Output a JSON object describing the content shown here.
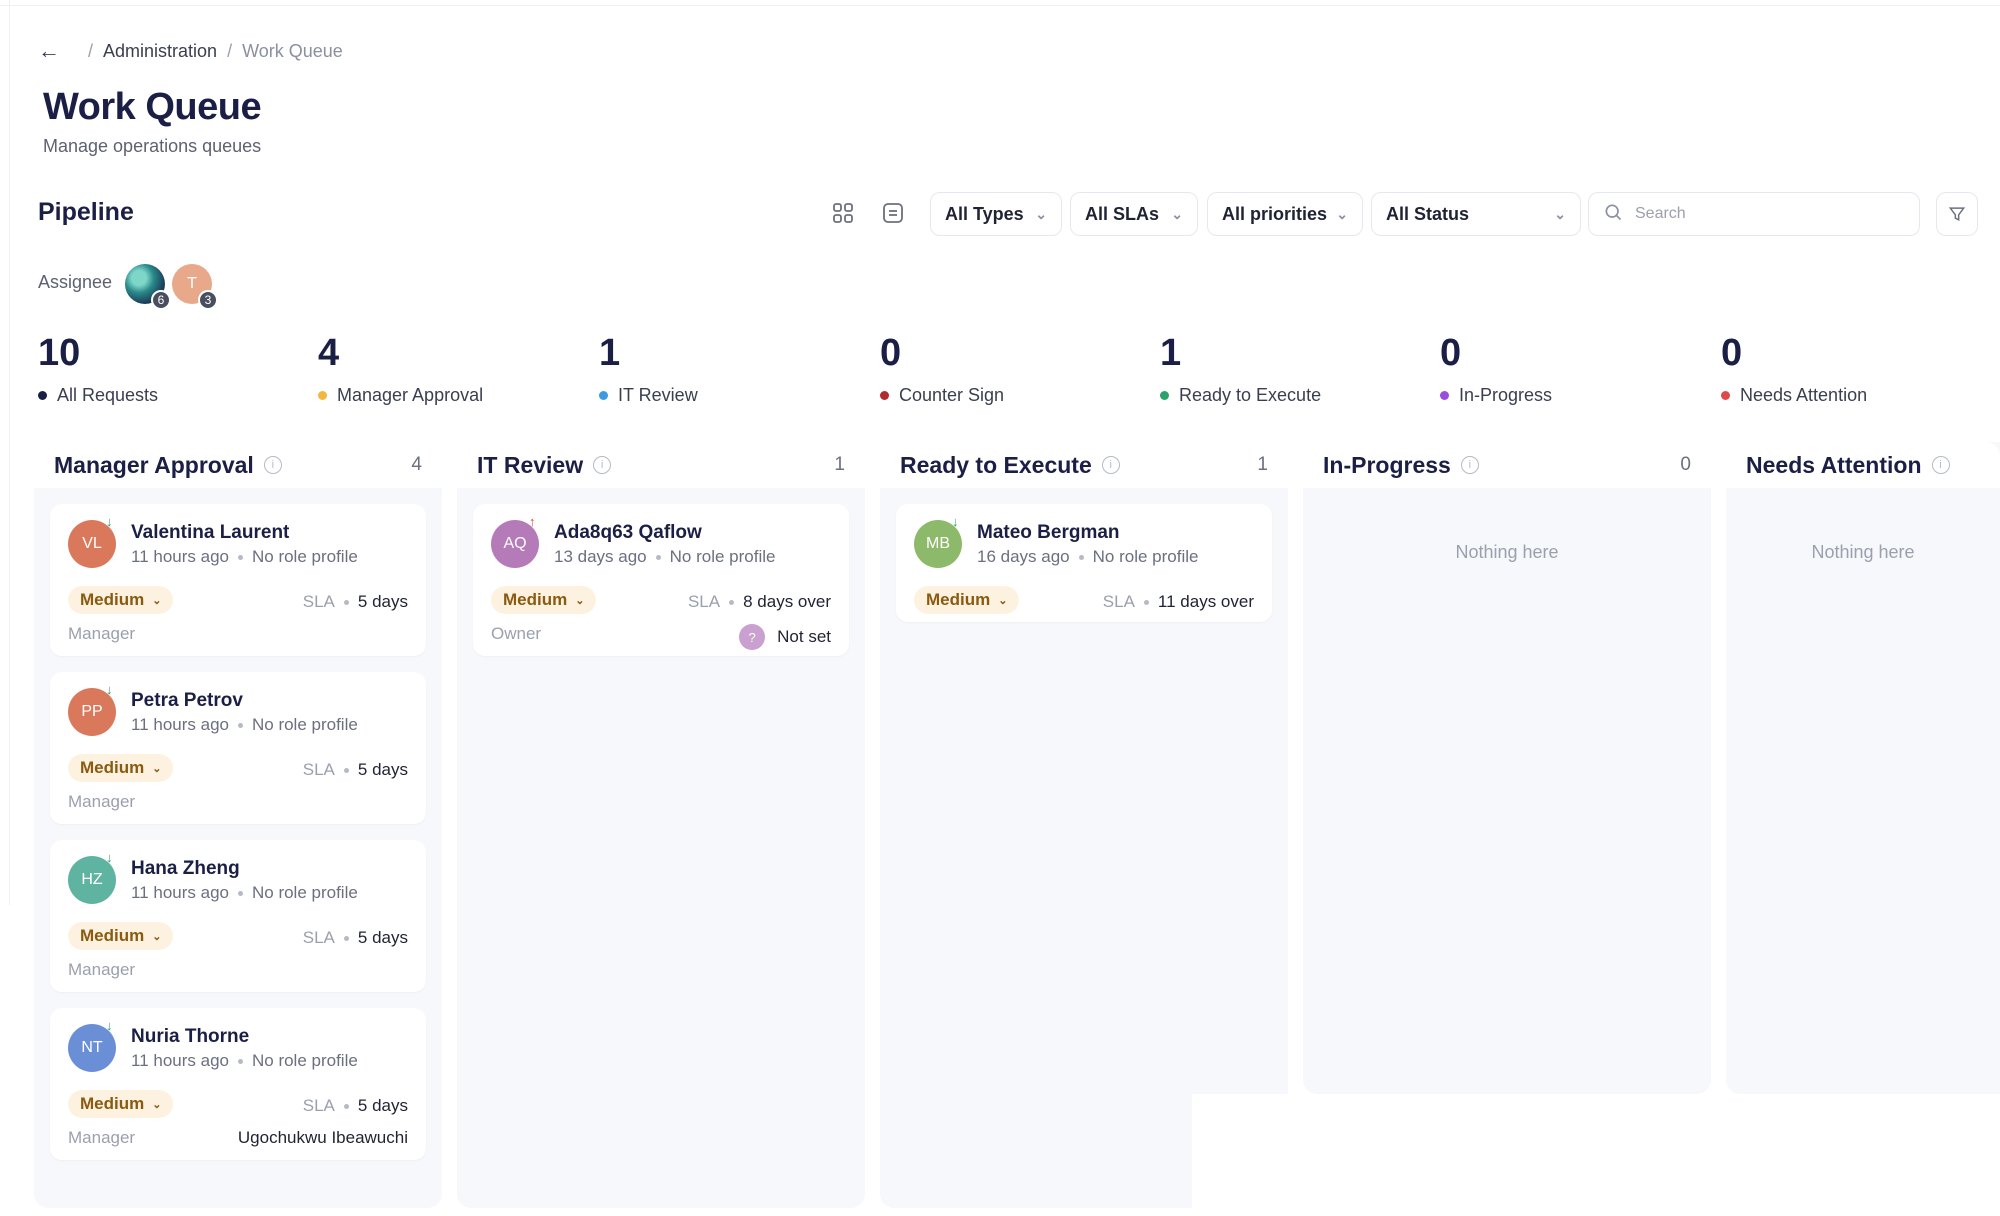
{
  "breadcrumb": {
    "back": "←",
    "separator": "/",
    "items": [
      "Administration",
      "Work Queue"
    ]
  },
  "page": {
    "title": "Work Queue",
    "subtitle": "Manage operations queues"
  },
  "pipeline": {
    "title": "Pipeline",
    "filters": {
      "types": "All Types",
      "slas": "All SLAs",
      "priorities": "All priorities",
      "status": "All Status"
    },
    "search_placeholder": "Search",
    "assignee": {
      "label": "Assignee",
      "avatars": [
        {
          "initials": "",
          "count": "6"
        },
        {
          "initials": "T",
          "count": "3"
        }
      ]
    }
  },
  "stats": [
    {
      "value": "10",
      "label": "All Requests",
      "color": "#1b1f45"
    },
    {
      "value": "4",
      "label": "Manager Approval",
      "color": "#f4b63c"
    },
    {
      "value": "1",
      "label": "IT Review",
      "color": "#3b9be0"
    },
    {
      "value": "0",
      "label": "Counter Sign",
      "color": "#b5282c"
    },
    {
      "value": "1",
      "label": "Ready to Execute",
      "color": "#2aa36a"
    },
    {
      "value": "0",
      "label": "In-Progress",
      "color": "#9a4de0"
    },
    {
      "value": "0",
      "label": "Needs Attention",
      "color": "#e04848"
    }
  ],
  "columns": [
    {
      "title": "Manager Approval",
      "count": "4",
      "cards": [
        {
          "initials": "VL",
          "name": "Valentina Laurent",
          "time": "11 hours ago",
          "role": "No role profile",
          "priority": "Medium",
          "sla_label": "SLA",
          "sla": "5 days",
          "field_label": "Manager",
          "field_value": "",
          "avatar_color": "#d9785a",
          "arrow": "↓",
          "arrow_color": "#2aa36a"
        },
        {
          "initials": "PP",
          "name": "Petra Petrov",
          "time": "11 hours ago",
          "role": "No role profile",
          "priority": "Medium",
          "sla_label": "SLA",
          "sla": "5 days",
          "field_label": "Manager",
          "field_value": "",
          "avatar_color": "#d9785a",
          "arrow": "↓",
          "arrow_color": "#2aa36a"
        },
        {
          "initials": "HZ",
          "name": "Hana Zheng",
          "time": "11 hours ago",
          "role": "No role profile",
          "priority": "Medium",
          "sla_label": "SLA",
          "sla": "5 days",
          "field_label": "Manager",
          "field_value": "",
          "avatar_color": "#5fb3a1",
          "arrow": "↓",
          "arrow_color": "#2aa36a"
        },
        {
          "initials": "NT",
          "name": "Nuria Thorne",
          "time": "11 hours ago",
          "role": "No role profile",
          "priority": "Medium",
          "sla_label": "SLA",
          "sla": "5 days",
          "field_label": "Manager",
          "field_value": "Ugochukwu Ibeawuchi",
          "avatar_color": "#6b8fd6",
          "arrow": "↓",
          "arrow_color": "#2aa36a"
        }
      ]
    },
    {
      "title": "IT Review",
      "count": "1",
      "cards": [
        {
          "initials": "AQ",
          "name": "Ada8q63 Qaflow",
          "time": "13 days ago",
          "role": "No role profile",
          "priority": "Medium",
          "sla_label": "SLA",
          "sla": "8 days over",
          "field_label": "Owner",
          "field_value": "Not set",
          "field_icon": "?",
          "avatar_color": "#b57ab8",
          "arrow": "↑",
          "arrow_color": "#e04848"
        }
      ]
    },
    {
      "title": "Ready to Execute",
      "count": "1",
      "cards": [
        {
          "initials": "MB",
          "name": "Mateo Bergman",
          "time": "16 days ago",
          "role": "No role profile",
          "priority": "Medium",
          "sla_label": "SLA",
          "sla": "11 days over",
          "field_label": "",
          "field_value": "",
          "avatar_color": "#8cba6a",
          "arrow": "↓",
          "arrow_color": "#2aa36a"
        }
      ]
    },
    {
      "title": "In-Progress",
      "count": "0",
      "empty": "Nothing here"
    },
    {
      "title": "Needs Attention",
      "count": "",
      "empty": "Nothing here"
    }
  ],
  "icons": {
    "back": "arrow-left-icon",
    "grid_view": "grid-icon",
    "list_view": "list-icon",
    "chevron": "chevron-down-icon",
    "search": "search-icon",
    "filter": "funnel-icon",
    "info": "info-icon"
  }
}
